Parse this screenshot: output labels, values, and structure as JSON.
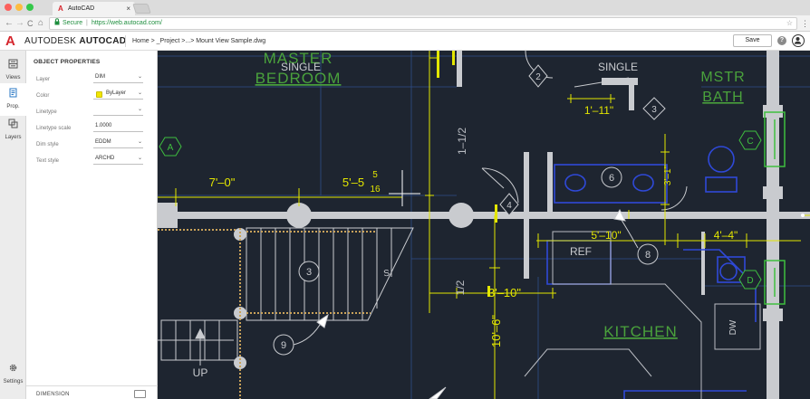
{
  "browser": {
    "tab_title": "AutoCAD",
    "tab_logo": "A",
    "tab_close": "×",
    "security_label": "Secure",
    "url": "https://web.autocad.com/",
    "nav_back": "←",
    "nav_forward": "→",
    "nav_reload": "C",
    "nav_home": "⌂",
    "star_glyph": "☆",
    "menu_glyph": "⋮",
    "lock_glyph": "🔒"
  },
  "app": {
    "logo": "A",
    "brand_light": "AUTODESK",
    "brand_bold": "AUTOCAD",
    "breadcrumb": "Home > _Project >...> Mount View Sample.dwg",
    "save_label": "Save",
    "help_glyph": "?"
  },
  "sidebar": {
    "items": [
      {
        "label": "Views",
        "icon": "views-icon"
      },
      {
        "label": "Prop.",
        "icon": "properties-icon"
      },
      {
        "label": "Layers",
        "icon": "layers-icon"
      }
    ],
    "settings_label": "Settings"
  },
  "properties": {
    "title": "OBJECT PROPERTIES",
    "rows": [
      {
        "label": "Layer",
        "value": "DIM"
      },
      {
        "label": "Color",
        "value": "ByLayer"
      },
      {
        "label": "Linetype",
        "value": ""
      },
      {
        "label": "Linetype scale",
        "value": "1.0000"
      },
      {
        "label": "Dim style",
        "value": "EDDM"
      },
      {
        "label": "Text style",
        "value": "ARCHD"
      }
    ],
    "chevron": "⌄",
    "footer_label": "DIMENSION"
  },
  "drawing": {
    "room_labels": {
      "master_1": "MASTER",
      "master_2": "BEDROOM",
      "single_left": "SINGLE",
      "single_right": "SINGLE",
      "mstr_1": "MSTR",
      "mstr_2": "BATH",
      "kitchen": "KITCHEN",
      "ref": "REF",
      "up": "UP",
      "dw": "DW",
      "s_mark": "S"
    },
    "dimensions": {
      "d_7_0": "7'–0\"",
      "d_5_5": "5'–5",
      "d_frac_top": "5",
      "d_frac_bot": "16",
      "d_1_11": "1'–11\"",
      "d_3_1": "3'–1\"",
      "d_5_10": "5'–10\"",
      "d_4_4": "4'–4\"",
      "d_3_10": "3'–10\"",
      "d_10_6": "10'–6\"",
      "d_1_half_a": "1–1/2",
      "d_1_half_b": "1/2"
    },
    "callouts": {
      "c2": "2",
      "c3a": "3",
      "c3b": "3",
      "c4": "4",
      "c6": "6",
      "c8": "8",
      "c9": "9",
      "hA": "A",
      "hC": "C",
      "hD": "D"
    }
  },
  "colors": {
    "canvas_bg": "#1e2530",
    "wall": "#cfcfcf",
    "dim": "#e3e600",
    "room_text": "#4aa23c",
    "fixture": "#2f49d8",
    "grid_tag": "#3fbf3f",
    "brand_red": "#d5262d"
  }
}
